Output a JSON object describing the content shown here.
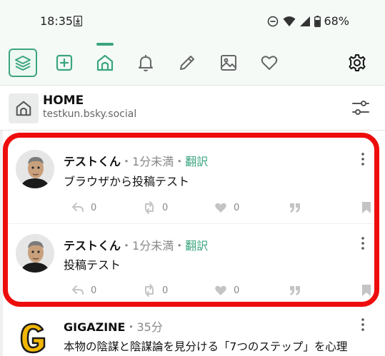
{
  "status_bar": {
    "time": "18:35",
    "battery": "68%"
  },
  "toolbar": {
    "items": [
      {
        "name": "layers",
        "active": false
      },
      {
        "name": "new-post",
        "active": false
      },
      {
        "name": "home",
        "active": true
      },
      {
        "name": "notifications",
        "active": false
      },
      {
        "name": "compose",
        "active": false
      },
      {
        "name": "media",
        "active": false
      },
      {
        "name": "favorites",
        "active": false
      },
      {
        "name": "settings",
        "active": false
      }
    ],
    "accent": "#3aa57e"
  },
  "column": {
    "title": "HOME",
    "account": "testkun.bsky.social"
  },
  "posts": [
    {
      "author": "テストくん",
      "sep": "・",
      "time": "1分未満",
      "sep2": "・",
      "translate": "翻訳",
      "body": "ブラウザから投稿テスト",
      "reply_count": "0",
      "repost_count": "0",
      "like_count": "0"
    },
    {
      "author": "テストくん",
      "sep": "・",
      "time": "1分未満",
      "sep2": "・",
      "translate": "翻訳",
      "body": "投稿テスト",
      "reply_count": "0",
      "repost_count": "0",
      "like_count": "0"
    },
    {
      "author": "GIGAZINE",
      "sep": "・",
      "time": "35分",
      "body": "本物の陰謀と陰謀論を見分ける「7つのステップ」を心理"
    }
  ],
  "highlight_color": "#ee0d0d"
}
